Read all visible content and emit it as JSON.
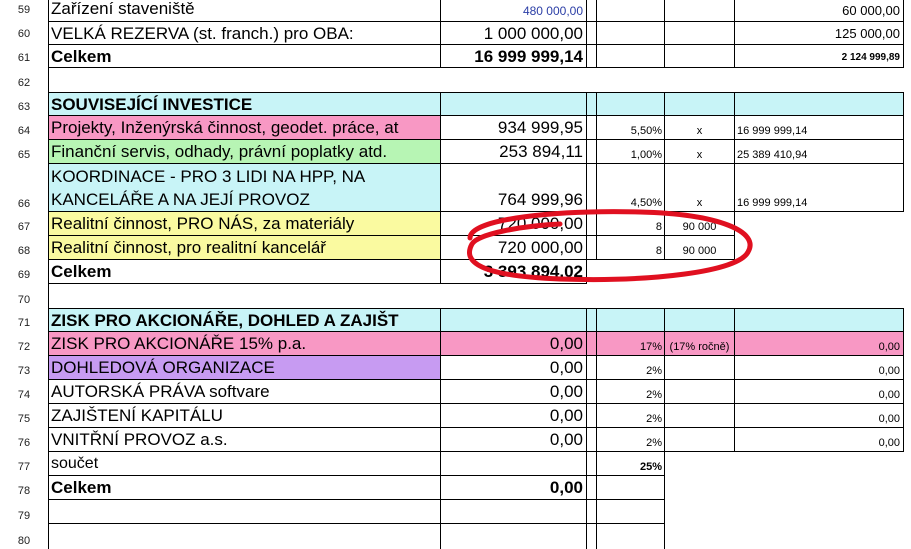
{
  "rows": {
    "r59": {
      "num": "59",
      "label": "Zařízení staveniště",
      "value": "480 000,00",
      "col6": "60 000,00"
    },
    "r60": {
      "num": "60",
      "label": "VELKÁ REZERVA (st. franch.) pro OBA:",
      "value": "1 000 000,00",
      "col6": "125 000,00"
    },
    "r61": {
      "num": "61",
      "label": "Celkem",
      "value": "16 999 999,14",
      "col6": "2 124 999,89"
    },
    "r62": {
      "num": "62"
    },
    "r63": {
      "num": "63",
      "label": "SOUVISEJÍCÍ INVESTICE"
    },
    "r64": {
      "num": "64",
      "label": "Projekty, Inženýrská činnost, geodet. práce, at",
      "value": "934 999,95",
      "pct": "5,50%",
      "x": "x",
      "col6": "16 999 999,14"
    },
    "r65": {
      "num": "65",
      "label": "Finanční servis, odhady, právní poplatky atd.",
      "value": "253 894,11",
      "pct": "1,00%",
      "x": "x",
      "col6": "25 389 410,94"
    },
    "r66": {
      "num": "66",
      "label_line1": "KOORDINACE  - PRO 3 LIDI NA HPP, NA",
      "label_line2": "KANCELÁŘE A NA JEJÍ PROVOZ",
      "value": "764 999,96",
      "pct": "4,50%",
      "x": "x",
      "col6": "16 999 999,14"
    },
    "r67": {
      "num": "67",
      "label": "Realitní činnost, PRO NÁS, za materiály",
      "value": "720 000,00",
      "pct": "8",
      "x": "90 000"
    },
    "r68": {
      "num": "68",
      "label": "Realitní činnost, pro realitní kancelář",
      "value": "720 000,00",
      "pct": "8",
      "x": "90 000"
    },
    "r69": {
      "num": "69",
      "label": "Celkem",
      "value": "3 393 894,02"
    },
    "r70": {
      "num": "70"
    },
    "r71": {
      "num": "71",
      "label": "ZISK PRO AKCIONÁŘE, DOHLED A ZAJIŠT"
    },
    "r72": {
      "num": "72",
      "label": "ZISK PRO AKCIONÁŘE 15% p.a.",
      "value": "0,00",
      "pct": "17%",
      "x": "(17% ročně)",
      "col6": "0,00"
    },
    "r73": {
      "num": "73",
      "label": "DOHLEDOVÁ ORGANIZACE",
      "value": "0,00",
      "pct": "2%",
      "col6": "0,00"
    },
    "r74": {
      "num": "74",
      "label": "AUTORSKÁ PRÁVA softvare",
      "value": "0,00",
      "pct": "2%",
      "col6": "0,00"
    },
    "r75": {
      "num": "75",
      "label": "ZAJIŠTENÍ KAPITÁLU",
      "value": "0,00",
      "pct": "2%",
      "col6": "0,00"
    },
    "r76": {
      "num": "76",
      "label": "VNITŘNÍ PROVOZ a.s.",
      "value": "0,00",
      "pct": "2%",
      "col6": "0,00"
    },
    "r77": {
      "num": "77",
      "label": "součet",
      "pct": "25%"
    },
    "r78": {
      "num": "78",
      "label": "Celkem",
      "value": "0,00"
    },
    "r79": {
      "num": "79"
    },
    "r80": {
      "num": "80"
    }
  },
  "annotation": {
    "color": "#e01020",
    "shape": "red-ellipse"
  }
}
